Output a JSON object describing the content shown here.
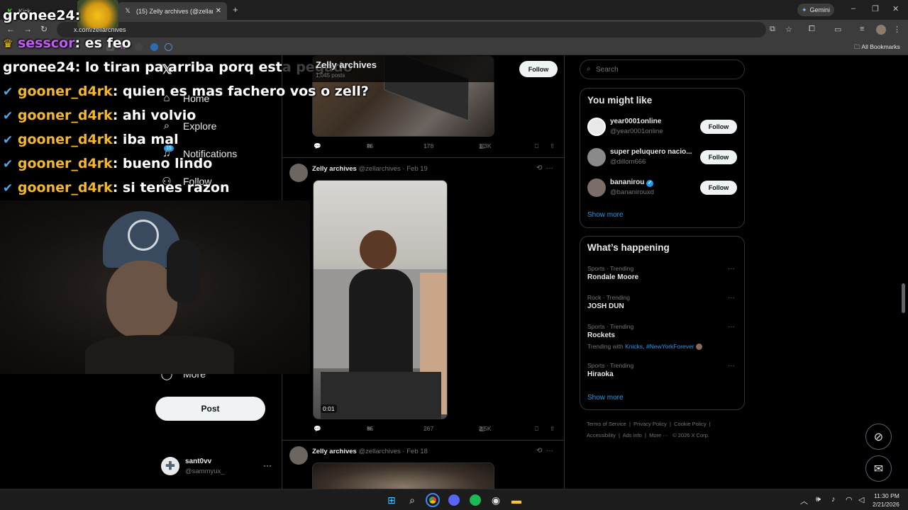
{
  "browser": {
    "tabs": [
      {
        "title": "Kick",
        "active": false
      },
      {
        "title": "(15) Zelly archives (@zellarchives",
        "active": false
      }
    ],
    "url": "x.com/zellarchives",
    "gemini_label": "Gemini",
    "all_bookmarks": "All Bookmarks"
  },
  "stream_chat": [
    {
      "user": "gronee24",
      "msg": ": ",
      "badge": ""
    },
    {
      "user": "sesscor",
      "msg": ": es feo",
      "badge": "crown"
    },
    {
      "user": "gronee24",
      "msg": ": lo tiran pa arriba porq esta pegado",
      "badge": ""
    },
    {
      "user": "gooner_d4rk",
      "msg": ": quien es mas fachero vos o zell?",
      "badge": "check"
    },
    {
      "user": "gooner_d4rk",
      "msg": ": ahi volvio",
      "badge": "check"
    },
    {
      "user": "gooner_d4rk",
      "msg": ": iba mal",
      "badge": "check"
    },
    {
      "user": "gooner_d4rk",
      "msg": ": bueno lindo",
      "badge": "check"
    },
    {
      "user": "gooner_d4rk",
      "msg": ": si tenes razon",
      "badge": "check"
    }
  ],
  "left_nav": {
    "items": [
      {
        "label": "Home",
        "icon": "home-icon"
      },
      {
        "label": "Explore",
        "icon": "search-icon"
      },
      {
        "label": "Notifications",
        "icon": "bell-icon",
        "badge": "15"
      },
      {
        "label": "Follow",
        "icon": "person-add-icon"
      },
      {
        "label": "More",
        "icon": "more-circle-icon"
      }
    ],
    "post_label": "Post",
    "account": {
      "name": "sant0vv",
      "handle": "@sammyux_"
    }
  },
  "profile_header": {
    "name": "Zelly archives",
    "posts": "1,045 posts",
    "follow_label": "Follow"
  },
  "posts": [
    {
      "replies": "",
      "reposts": "25",
      "likes": "178",
      "views": "1.3K"
    },
    {
      "author": "Zelly archives",
      "handle": "@zellarchives",
      "date": "Feb 19",
      "duration": "0:01",
      "replies": "",
      "reposts": "35",
      "likes": "267",
      "views": "2.5K"
    },
    {
      "author": "Zelly archives",
      "handle": "@zellarchives",
      "date": "Feb 18"
    }
  ],
  "right_sidebar": {
    "search_placeholder": "Search",
    "you_might_like": {
      "title": "You might like",
      "users": [
        {
          "name": "year0001online",
          "handle": "@year0001online",
          "follow": "Follow",
          "avatar_color": "#e8e8e8"
        },
        {
          "name": "super peluquero nacio...",
          "handle": "@dillom666",
          "follow": "Follow",
          "avatar_color": "#8a8a8a"
        },
        {
          "name": "bananirou",
          "handle": "@bananirouxd",
          "follow": "Follow",
          "verified": true,
          "avatar_color": "#7a6e66"
        }
      ],
      "show_more": "Show more"
    },
    "whats_happening": {
      "title": "What’s happening",
      "trends": [
        {
          "category": "Sports · Trending",
          "name": "Rondale Moore"
        },
        {
          "category": "Rock · Trending",
          "name": "JOSH DUN"
        },
        {
          "category": "Sports · Trending",
          "name": "Rockets",
          "with_prefix": "Trending with",
          "with_links": "Knicks, #NewYorkForever"
        },
        {
          "category": "Sports · Trending",
          "name": "Hiraoka"
        }
      ],
      "show_more": "Show more"
    },
    "footer": {
      "line1": [
        "Terms of Service",
        "Privacy Policy",
        "Cookie Policy"
      ],
      "line2": [
        "Accessibility",
        "Ads info",
        "More ···",
        "© 2026 X Corp."
      ]
    }
  },
  "taskbar": {
    "time": "11:30 PM",
    "date": "2/21/2026"
  },
  "colors": {
    "accent": "#1d9bf0",
    "chat_user_yellow": "#f2b731",
    "chat_user_purple": "#c25cf0"
  }
}
